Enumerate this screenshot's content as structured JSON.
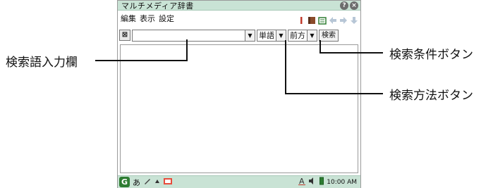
{
  "window": {
    "title": "マルチメディア辞書",
    "help_label": "?",
    "close_label": "×"
  },
  "menu": {
    "items": [
      "編集",
      "表示",
      "設定"
    ]
  },
  "searchbar": {
    "clear_label": "⊠",
    "input_value": "",
    "dropdown_arrow": "▼",
    "method_value": "単語",
    "condition_value": "前方",
    "search_button": "検索"
  },
  "taskbar": {
    "start_label": "G",
    "ime_label": "あ",
    "clock": "10:00 AM"
  },
  "callouts": {
    "input_field": "検索語入力欄",
    "condition_button": "検索条件ボタン",
    "method_button": "検索方法ボタン"
  },
  "colors": {
    "titlebar": "#c9e3d5",
    "accent_red": "#c0392b",
    "accent_green": "#2e7d32"
  }
}
